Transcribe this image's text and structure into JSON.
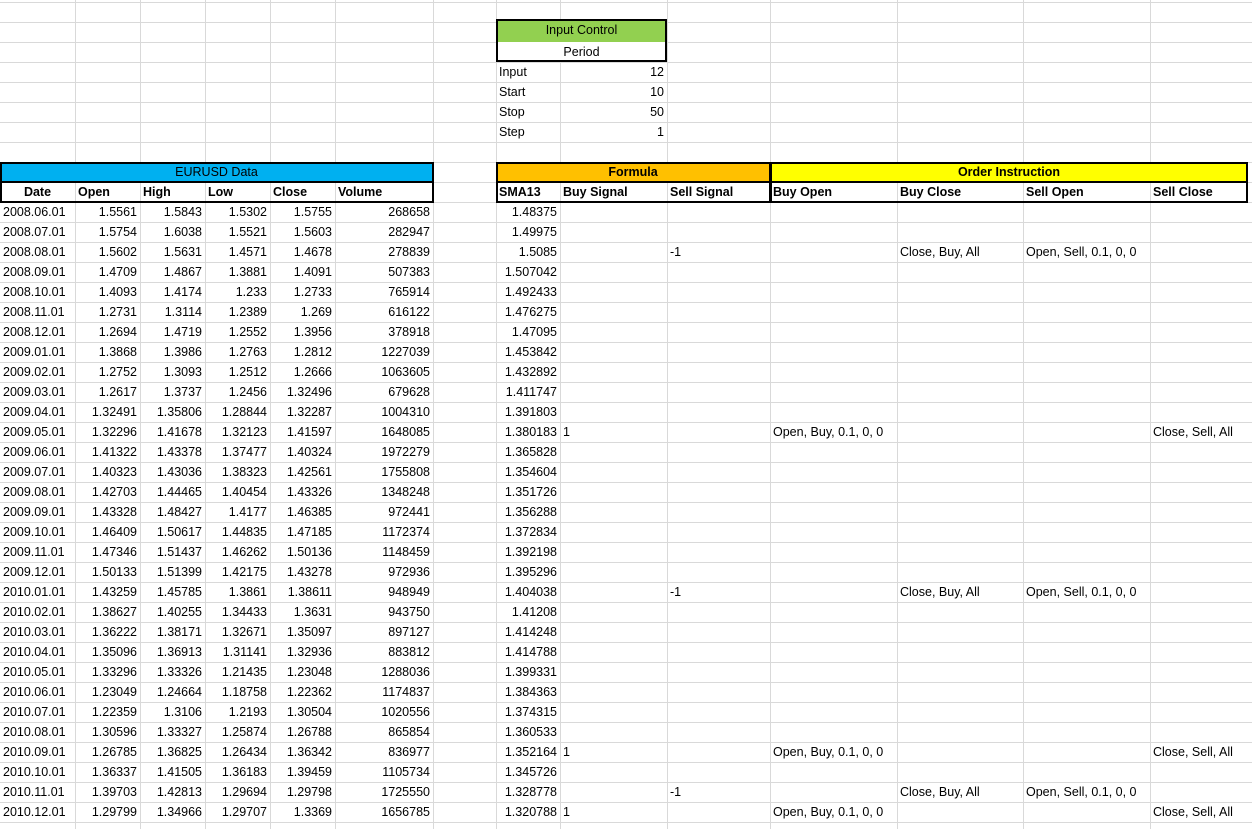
{
  "input_control": {
    "title": "Input Control",
    "subtitle": "Period",
    "rows": [
      {
        "label": "Input",
        "value": "12"
      },
      {
        "label": "Start",
        "value": "10"
      },
      {
        "label": "Stop",
        "value": "50"
      },
      {
        "label": "Step",
        "value": "1"
      }
    ]
  },
  "sections": {
    "eurusd": "EURUSD Data",
    "formula": "Formula",
    "order": "Order Instruction"
  },
  "colors": {
    "input_control_header": "#92d050",
    "eurusd_header": "#00b0f0",
    "formula_header": "#ffc000",
    "order_header": "#ffff00",
    "gridline": "#d9d9d9"
  },
  "headers": [
    "Date",
    "Open",
    "High",
    "Low",
    "Close",
    "Volume",
    "SMA13",
    "Buy  Signal",
    "Sell Signal",
    "Buy Open",
    "Buy Close",
    "Sell Open",
    "Sell Close"
  ],
  "rows": [
    [
      "2008.06.01",
      "1.5561",
      "1.5843",
      "1.5302",
      "1.5755",
      "268658",
      "1.48375",
      "",
      "",
      "",
      "",
      "",
      ""
    ],
    [
      "2008.07.01",
      "1.5754",
      "1.6038",
      "1.5521",
      "1.5603",
      "282947",
      "1.49975",
      "",
      "",
      "",
      "",
      "",
      ""
    ],
    [
      "2008.08.01",
      "1.5602",
      "1.5631",
      "1.4571",
      "1.4678",
      "278839",
      "1.5085",
      "",
      "-1",
      "",
      "Close, Buy, All",
      "Open, Sell, 0.1, 0, 0",
      ""
    ],
    [
      "2008.09.01",
      "1.4709",
      "1.4867",
      "1.3881",
      "1.4091",
      "507383",
      "1.507042",
      "",
      "",
      "",
      "",
      "",
      ""
    ],
    [
      "2008.10.01",
      "1.4093",
      "1.4174",
      "1.233",
      "1.2733",
      "765914",
      "1.492433",
      "",
      "",
      "",
      "",
      "",
      ""
    ],
    [
      "2008.11.01",
      "1.2731",
      "1.3114",
      "1.2389",
      "1.269",
      "616122",
      "1.476275",
      "",
      "",
      "",
      "",
      "",
      ""
    ],
    [
      "2008.12.01",
      "1.2694",
      "1.4719",
      "1.2552",
      "1.3956",
      "378918",
      "1.47095",
      "",
      "",
      "",
      "",
      "",
      ""
    ],
    [
      "2009.01.01",
      "1.3868",
      "1.3986",
      "1.2763",
      "1.2812",
      "1227039",
      "1.453842",
      "",
      "",
      "",
      "",
      "",
      ""
    ],
    [
      "2009.02.01",
      "1.2752",
      "1.3093",
      "1.2512",
      "1.2666",
      "1063605",
      "1.432892",
      "",
      "",
      "",
      "",
      "",
      ""
    ],
    [
      "2009.03.01",
      "1.2617",
      "1.3737",
      "1.2456",
      "1.32496",
      "679628",
      "1.411747",
      "",
      "",
      "",
      "",
      "",
      ""
    ],
    [
      "2009.04.01",
      "1.32491",
      "1.35806",
      "1.28844",
      "1.32287",
      "1004310",
      "1.391803",
      "",
      "",
      "",
      "",
      "",
      ""
    ],
    [
      "2009.05.01",
      "1.32296",
      "1.41678",
      "1.32123",
      "1.41597",
      "1648085",
      "1.380183",
      "1",
      "",
      "Open, Buy, 0.1, 0, 0",
      "",
      "",
      "Close, Sell, All"
    ],
    [
      "2009.06.01",
      "1.41322",
      "1.43378",
      "1.37477",
      "1.40324",
      "1972279",
      "1.365828",
      "",
      "",
      "",
      "",
      "",
      ""
    ],
    [
      "2009.07.01",
      "1.40323",
      "1.43036",
      "1.38323",
      "1.42561",
      "1755808",
      "1.354604",
      "",
      "",
      "",
      "",
      "",
      ""
    ],
    [
      "2009.08.01",
      "1.42703",
      "1.44465",
      "1.40454",
      "1.43326",
      "1348248",
      "1.351726",
      "",
      "",
      "",
      "",
      "",
      ""
    ],
    [
      "2009.09.01",
      "1.43328",
      "1.48427",
      "1.4177",
      "1.46385",
      "972441",
      "1.356288",
      "",
      "",
      "",
      "",
      "",
      ""
    ],
    [
      "2009.10.01",
      "1.46409",
      "1.50617",
      "1.44835",
      "1.47185",
      "1172374",
      "1.372834",
      "",
      "",
      "",
      "",
      "",
      ""
    ],
    [
      "2009.11.01",
      "1.47346",
      "1.51437",
      "1.46262",
      "1.50136",
      "1148459",
      "1.392198",
      "",
      "",
      "",
      "",
      "",
      ""
    ],
    [
      "2009.12.01",
      "1.50133",
      "1.51399",
      "1.42175",
      "1.43278",
      "972936",
      "1.395296",
      "",
      "",
      "",
      "",
      "",
      ""
    ],
    [
      "2010.01.01",
      "1.43259",
      "1.45785",
      "1.3861",
      "1.38611",
      "948949",
      "1.404038",
      "",
      "-1",
      "",
      "Close, Buy, All",
      "Open, Sell, 0.1, 0, 0",
      ""
    ],
    [
      "2010.02.01",
      "1.38627",
      "1.40255",
      "1.34433",
      "1.3631",
      "943750",
      "1.41208",
      "",
      "",
      "",
      "",
      "",
      ""
    ],
    [
      "2010.03.01",
      "1.36222",
      "1.38171",
      "1.32671",
      "1.35097",
      "897127",
      "1.414248",
      "",
      "",
      "",
      "",
      "",
      ""
    ],
    [
      "2010.04.01",
      "1.35096",
      "1.36913",
      "1.31141",
      "1.32936",
      "883812",
      "1.414788",
      "",
      "",
      "",
      "",
      "",
      ""
    ],
    [
      "2010.05.01",
      "1.33296",
      "1.33326",
      "1.21435",
      "1.23048",
      "1288036",
      "1.399331",
      "",
      "",
      "",
      "",
      "",
      ""
    ],
    [
      "2010.06.01",
      "1.23049",
      "1.24664",
      "1.18758",
      "1.22362",
      "1174837",
      "1.384363",
      "",
      "",
      "",
      "",
      "",
      ""
    ],
    [
      "2010.07.01",
      "1.22359",
      "1.3106",
      "1.2193",
      "1.30504",
      "1020556",
      "1.374315",
      "",
      "",
      "",
      "",
      "",
      ""
    ],
    [
      "2010.08.01",
      "1.30596",
      "1.33327",
      "1.25874",
      "1.26788",
      "865854",
      "1.360533",
      "",
      "",
      "",
      "",
      "",
      ""
    ],
    [
      "2010.09.01",
      "1.26785",
      "1.36825",
      "1.26434",
      "1.36342",
      "836977",
      "1.352164",
      "1",
      "",
      "Open, Buy, 0.1, 0, 0",
      "",
      "",
      "Close, Sell, All"
    ],
    [
      "2010.10.01",
      "1.36337",
      "1.41505",
      "1.36183",
      "1.39459",
      "1105734",
      "1.345726",
      "",
      "",
      "",
      "",
      "",
      ""
    ],
    [
      "2010.11.01",
      "1.39703",
      "1.42813",
      "1.29694",
      "1.29798",
      "1725550",
      "1.328778",
      "",
      "-1",
      "",
      "Close, Buy, All",
      "Open, Sell, 0.1, 0, 0",
      ""
    ],
    [
      "2010.12.01",
      "1.29799",
      "1.34966",
      "1.29707",
      "1.3369",
      "1656785",
      "1.320788",
      "1",
      "",
      "Open, Buy, 0.1, 0, 0",
      "",
      "",
      "Close, Sell, All"
    ]
  ]
}
